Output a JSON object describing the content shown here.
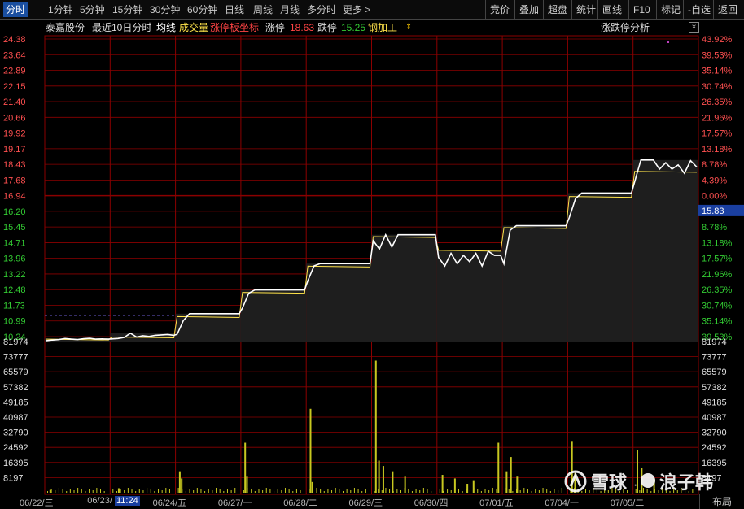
{
  "toolbar": {
    "periods": [
      "分时",
      "1分钟",
      "5分钟",
      "15分钟",
      "30分钟",
      "60分钟",
      "日线",
      "周线",
      "月线",
      "多分时",
      "更多 >"
    ],
    "right": [
      "竞价",
      "叠加",
      "超盘",
      "统计",
      "画线",
      "F10",
      "标记",
      "-自选",
      "返回"
    ]
  },
  "info": {
    "stock_name": "泰嘉股份",
    "mode": "最近10日分时",
    "avg_line": "均线",
    "volume": "成交量",
    "limit_axis": "涨停板坐标",
    "limit_up_label": "涨停",
    "limit_up_value": "18.63",
    "limit_down_label": "跌停",
    "limit_down_value": "15.25",
    "industry": "钢加工",
    "analysis": "涨跌停分析"
  },
  "colors": {
    "up": "#ff3b3b",
    "down": "#33cc33",
    "flat": "#ffffff",
    "grid": "#8b0000",
    "price": "#ffffff",
    "avg": "#ffe34a",
    "vol": "#c8c820",
    "highlight": "#1a4fa0"
  },
  "price_axis": {
    "left": [
      "24.38",
      "23.64",
      "22.89",
      "22.15",
      "21.40",
      "20.66",
      "19.92",
      "19.17",
      "18.43",
      "17.68",
      "16.94",
      "16.20",
      "15.45",
      "14.71",
      "13.96",
      "13.22",
      "12.48",
      "11.73",
      "10.99",
      "10.24"
    ],
    "right": [
      "43.92%",
      "39.53%",
      "35.14%",
      "30.74%",
      "26.35%",
      "21.96%",
      "17.57%",
      "13.18%",
      "8.78%",
      "4.39%",
      "0.00%",
      "",
      "8.78%",
      "13.18%",
      "17.57%",
      "21.96%",
      "26.35%",
      "30.74%",
      "35.14%",
      "39.53%"
    ],
    "current_price": "15.83"
  },
  "volume_axis": {
    "labels": [
      "81974",
      "73777",
      "65579",
      "57382",
      "49185",
      "40987",
      "32790",
      "24592",
      "16395",
      "8197"
    ],
    "right_last": "7",
    "tag": "124"
  },
  "dates": [
    "06/22/三",
    "06/23/",
    "06/24/五",
    "06/27/一",
    "06/28/二",
    "06/29/三",
    "06/30/四",
    "07/01/五",
    "07/04/一",
    "07/05/二"
  ],
  "time_hl": "11:24",
  "watermark": {
    "site": "雪球",
    "author": "浪子韩"
  },
  "layout_btn": "布局",
  "chart_data": {
    "type": "line",
    "title": "",
    "days": [
      "06/22",
      "06/23",
      "06/24",
      "06/27",
      "06/28",
      "06/29",
      "06/30",
      "07/01",
      "07/04",
      "07/05"
    ],
    "price_close_per_day": [
      10.12,
      10.3,
      11.33,
      12.46,
      13.71,
      15.08,
      14.1,
      15.51,
      17.06,
      18.3
    ],
    "avg_per_day": [
      10.08,
      10.18,
      11.15,
      12.3,
      13.55,
      14.95,
      14.3,
      15.38,
      16.86,
      18.05
    ],
    "price_series": [
      [
        10.05,
        10.08,
        10.1,
        10.15,
        10.12,
        10.1,
        10.14,
        10.16,
        10.12,
        10.13,
        10.12
      ],
      [
        10.13,
        10.15,
        10.2,
        10.4,
        10.22,
        10.28,
        10.25,
        10.3,
        10.32,
        10.34,
        10.3
      ],
      [
        10.35,
        11.0,
        11.33,
        11.33,
        11.33,
        11.33,
        11.33,
        11.33,
        11.33,
        11.33,
        11.33
      ],
      [
        11.6,
        12.3,
        12.46,
        12.46,
        12.46,
        12.46,
        12.46,
        12.46,
        12.46,
        12.46,
        12.46
      ],
      [
        12.9,
        13.6,
        13.71,
        13.71,
        13.71,
        13.71,
        13.71,
        13.71,
        13.71,
        13.71,
        13.71
      ],
      [
        14.8,
        14.4,
        15.08,
        14.5,
        15.08,
        15.08,
        15.08,
        15.08,
        15.08,
        15.08,
        15.08
      ],
      [
        14.0,
        13.6,
        14.2,
        13.7,
        14.1,
        13.8,
        14.2,
        13.6,
        14.3,
        14.1,
        14.1
      ],
      [
        13.7,
        15.3,
        15.51,
        15.51,
        15.51,
        15.51,
        15.51,
        15.51,
        15.51,
        15.51,
        15.51
      ],
      [
        15.9,
        16.8,
        17.06,
        17.06,
        17.06,
        17.06,
        17.06,
        17.06,
        17.06,
        17.06,
        17.06
      ],
      [
        17.6,
        18.63,
        18.63,
        18.63,
        18.2,
        18.5,
        18.2,
        18.4,
        18.0,
        18.6,
        18.3
      ]
    ],
    "volume_spikes": [
      {
        "day": 0,
        "pos": 0.05,
        "v": 1500
      },
      {
        "day": 1,
        "pos": 0.1,
        "v": 2500
      },
      {
        "day": 2,
        "pos": 0.03,
        "v": 12000
      },
      {
        "day": 2,
        "pos": 0.06,
        "v": 8000
      },
      {
        "day": 3,
        "pos": 0.03,
        "v": 28000
      },
      {
        "day": 3,
        "pos": 0.06,
        "v": 9000
      },
      {
        "day": 4,
        "pos": 0.03,
        "v": 47000
      },
      {
        "day": 4,
        "pos": 0.06,
        "v": 6000
      },
      {
        "day": 5,
        "pos": 0.03,
        "v": 74000
      },
      {
        "day": 5,
        "pos": 0.08,
        "v": 18000
      },
      {
        "day": 5,
        "pos": 0.15,
        "v": 15000
      },
      {
        "day": 5,
        "pos": 0.3,
        "v": 12000
      },
      {
        "day": 5,
        "pos": 0.5,
        "v": 9000
      },
      {
        "day": 6,
        "pos": 0.05,
        "v": 10000
      },
      {
        "day": 6,
        "pos": 0.25,
        "v": 8000
      },
      {
        "day": 6,
        "pos": 0.45,
        "v": 5000
      },
      {
        "day": 6,
        "pos": 0.55,
        "v": 7000
      },
      {
        "day": 6,
        "pos": 0.95,
        "v": 28000
      },
      {
        "day": 7,
        "pos": 0.03,
        "v": 12000
      },
      {
        "day": 7,
        "pos": 0.1,
        "v": 20000
      },
      {
        "day": 7,
        "pos": 0.2,
        "v": 9000
      },
      {
        "day": 8,
        "pos": 0.03,
        "v": 29000
      },
      {
        "day": 8,
        "pos": 0.08,
        "v": 11000
      },
      {
        "day": 9,
        "pos": 0.03,
        "v": 24000
      },
      {
        "day": 9,
        "pos": 0.1,
        "v": 14000
      },
      {
        "day": 9,
        "pos": 0.3,
        "v": 8000
      }
    ],
    "price_ylim": [
      10.24,
      24.38
    ],
    "volume_ylim": [
      0,
      81974
    ]
  }
}
